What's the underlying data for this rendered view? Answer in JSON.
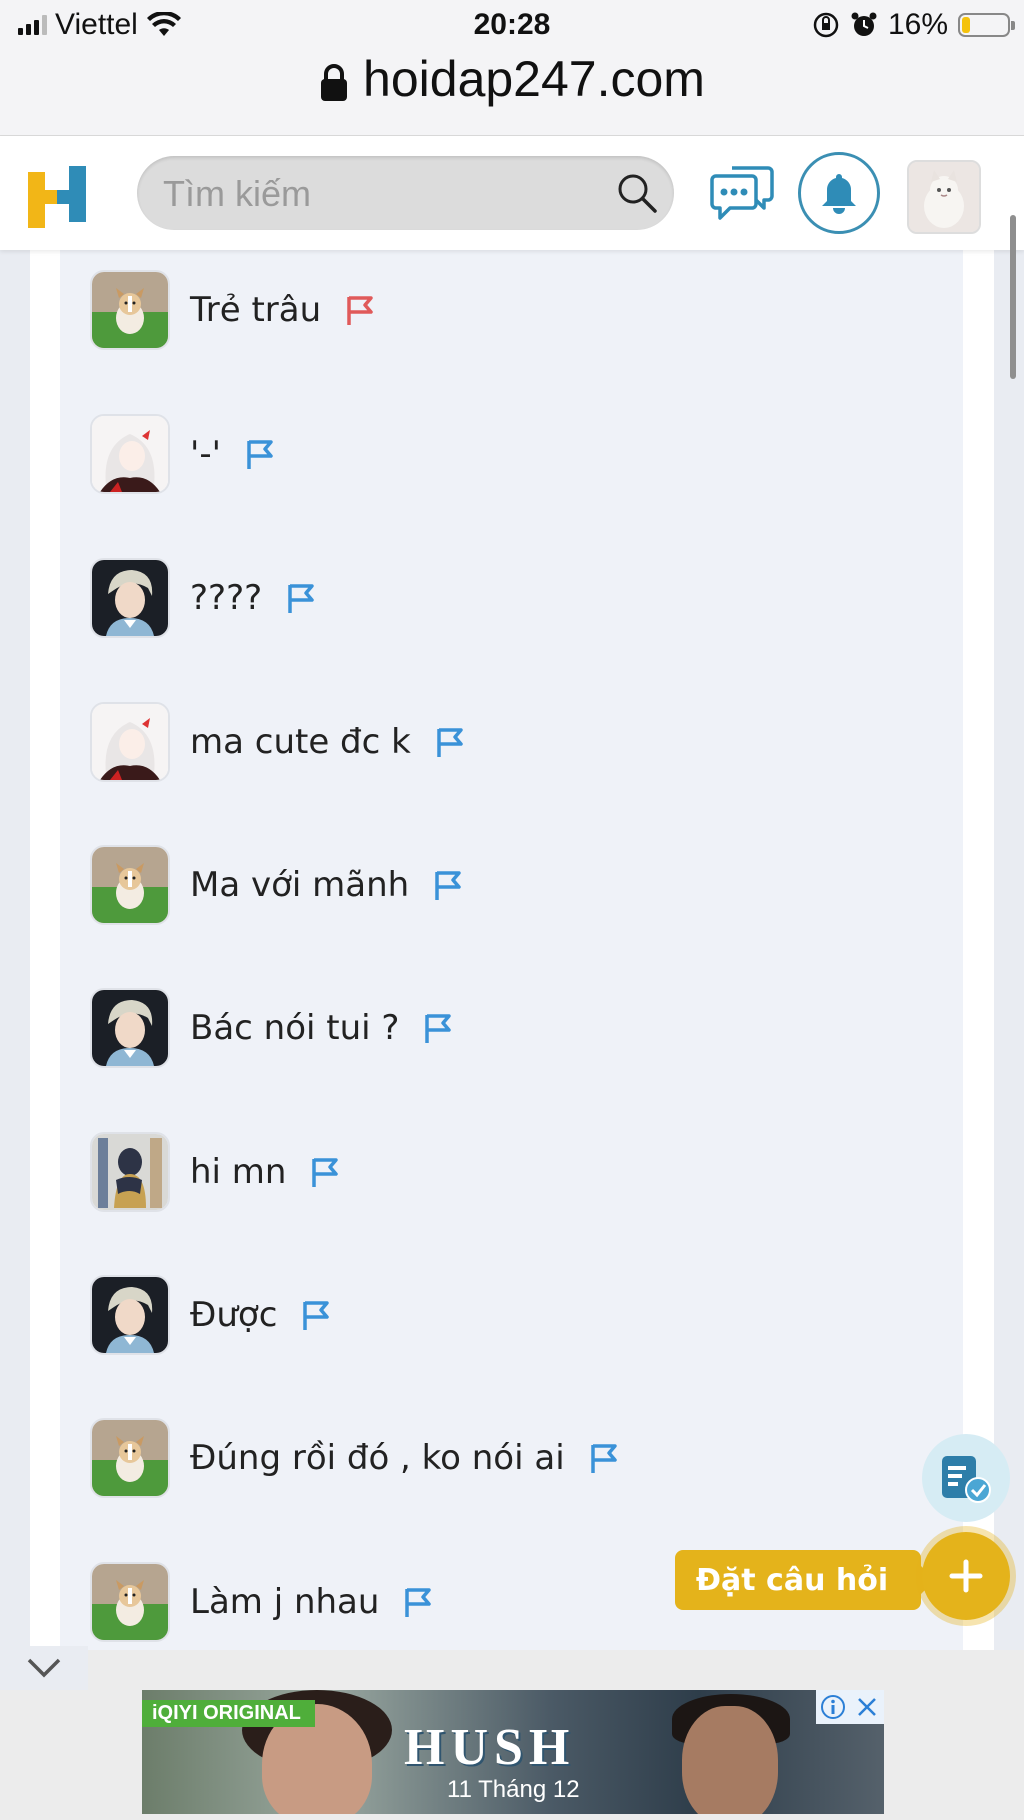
{
  "status_bar": {
    "carrier": "Viettel",
    "time": "20:28",
    "battery_percent": "16%"
  },
  "browser": {
    "url": "hoidap247.com"
  },
  "header": {
    "search_placeholder": "Tìm kiếm",
    "logo_letter": "H"
  },
  "comments": [
    {
      "text": "Trẻ trâu",
      "avatar": "dog",
      "flag_color": "#e05a5a"
    },
    {
      "text": "'-'",
      "avatar": "anime",
      "flag_color": "#3a92d8"
    },
    {
      "text": "????",
      "avatar": "boy",
      "flag_color": "#3a92d8"
    },
    {
      "text": "ma cute đc k",
      "avatar": "anime",
      "flag_color": "#3a92d8"
    },
    {
      "text": "Ma với mãnh",
      "avatar": "dog",
      "flag_color": "#3a92d8"
    },
    {
      "text": "Bác nói tui ?",
      "avatar": "boy",
      "flag_color": "#3a92d8"
    },
    {
      "text": "hi mn",
      "avatar": "person",
      "flag_color": "#3a92d8"
    },
    {
      "text": "Được",
      "avatar": "boy",
      "flag_color": "#3a92d8"
    },
    {
      "text": "Đúng rồi đó , ko nói ai",
      "avatar": "dog",
      "flag_color": "#3a92d8"
    },
    {
      "text": "Làm j nhau",
      "avatar": "dog",
      "flag_color": "#3a92d8"
    }
  ],
  "fab": {
    "ask_label": "Đặt câu hỏi"
  },
  "ad": {
    "badge": "iQIYI ORIGINAL",
    "title": "HUSH",
    "date": "11 Tháng 12"
  },
  "colors": {
    "brand_yellow": "#e4b31b",
    "brand_blue": "#3b8fb3",
    "report_flag": "#3a92d8",
    "report_flag_own": "#e05a5a"
  }
}
